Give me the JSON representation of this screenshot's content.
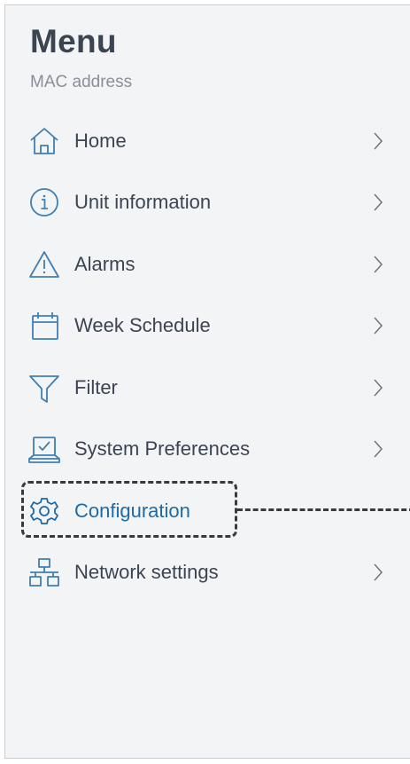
{
  "menu": {
    "title": "Menu",
    "subtitle": "MAC address",
    "items": [
      {
        "label": "Home",
        "icon": "home-icon",
        "chevron": true
      },
      {
        "label": "Unit information",
        "icon": "info-icon",
        "chevron": true
      },
      {
        "label": "Alarms",
        "icon": "warning-icon",
        "chevron": true
      },
      {
        "label": "Week Schedule",
        "icon": "calendar-icon",
        "chevron": true
      },
      {
        "label": "Filter",
        "icon": "filter-icon",
        "chevron": true
      },
      {
        "label": "System Preferences",
        "icon": "laptop-check-icon",
        "chevron": true
      },
      {
        "label": "Configuration",
        "icon": "gear-icon",
        "chevron": false,
        "active": true
      },
      {
        "label": "Network settings",
        "icon": "network-icon",
        "chevron": true
      }
    ]
  },
  "colors": {
    "panel_bg": "#f3f4f6",
    "text": "#3d4451",
    "icon": "#3f7fb3",
    "active": "#1f6aa5",
    "annotation": "#3a3a3a"
  }
}
